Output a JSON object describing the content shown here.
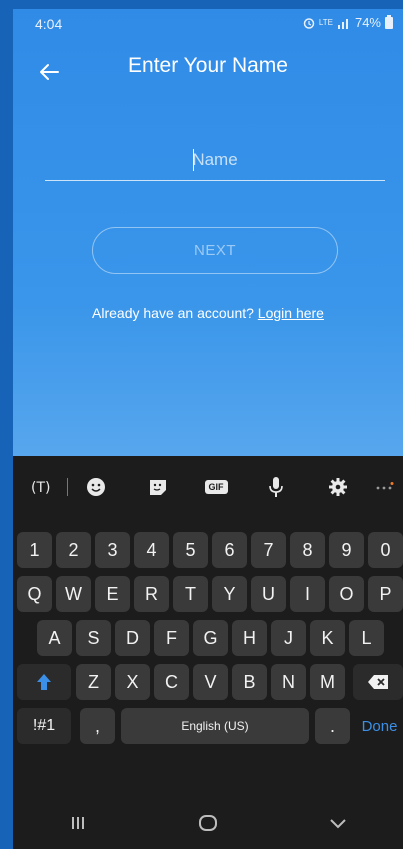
{
  "status": {
    "time": "4:04",
    "network": "LTE",
    "battery": "74%"
  },
  "header": {
    "title": "Enter Your Name"
  },
  "form": {
    "name_placeholder": "Name",
    "name_value": "",
    "next_label": "NEXT"
  },
  "account": {
    "prompt": "Already have an account?",
    "login_label": "Login here"
  },
  "keyboard": {
    "number_row": [
      "1",
      "2",
      "3",
      "4",
      "5",
      "6",
      "7",
      "8",
      "9",
      "0"
    ],
    "row1": [
      "Q",
      "W",
      "E",
      "R",
      "T",
      "Y",
      "U",
      "I",
      "O",
      "P"
    ],
    "row2": [
      "A",
      "S",
      "D",
      "F",
      "G",
      "H",
      "J",
      "K",
      "L"
    ],
    "row3": [
      "Z",
      "X",
      "C",
      "V",
      "B",
      "N",
      "M"
    ],
    "symbols_label": "!#1",
    "comma": ",",
    "space_label": "English (US)",
    "period": ".",
    "done_label": "Done",
    "gif_label": "GIF"
  },
  "colors": {
    "accent": "#3b8fe6",
    "background_top": "#2f8be6",
    "keyboard": "#1c1c1c"
  }
}
